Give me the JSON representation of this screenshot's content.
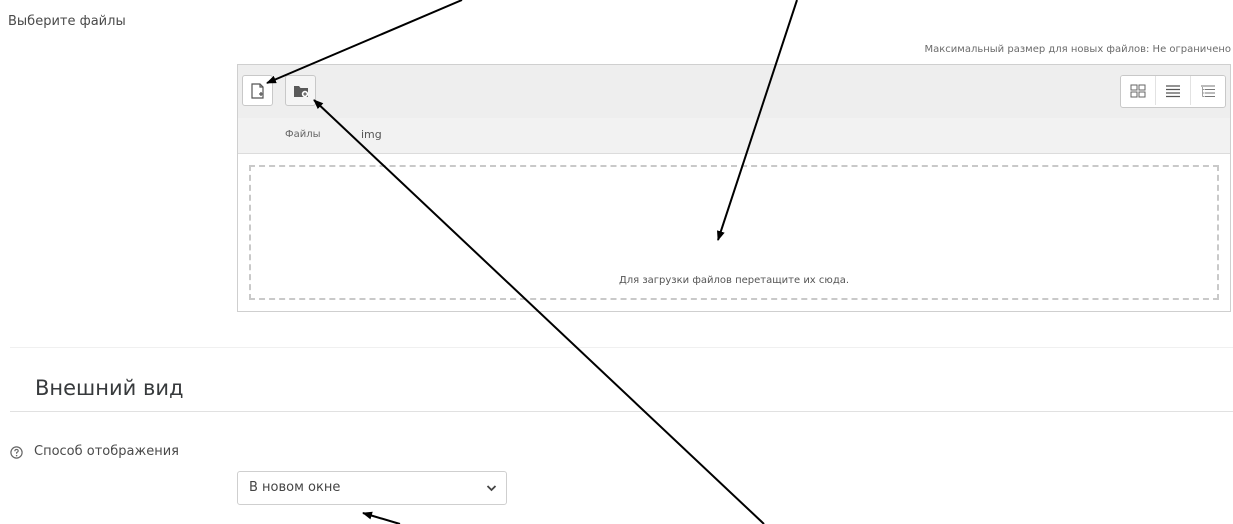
{
  "files_field": {
    "label": "Выберите файлы",
    "max_size_text": "Максимальный размер для новых файлов: Не ограничено"
  },
  "filepicker": {
    "toolbar": {
      "add_file_icon": "add-file-icon",
      "create_folder_icon": "create-folder-icon",
      "view_modes": [
        "icons-view-icon",
        "list-view-icon",
        "tree-view-icon"
      ]
    },
    "path": [
      "Файлы",
      "img"
    ],
    "dropzone_text": "Для загрузки файлов перетащите их сюда."
  },
  "appearance": {
    "section_title": "Внешний вид",
    "display_label": "Способ отображения",
    "display_value": "В новом окне"
  },
  "colors": {
    "arrow": "#000000",
    "toolbar_bg": "#eeeeee",
    "border": "#cfcfcf"
  }
}
